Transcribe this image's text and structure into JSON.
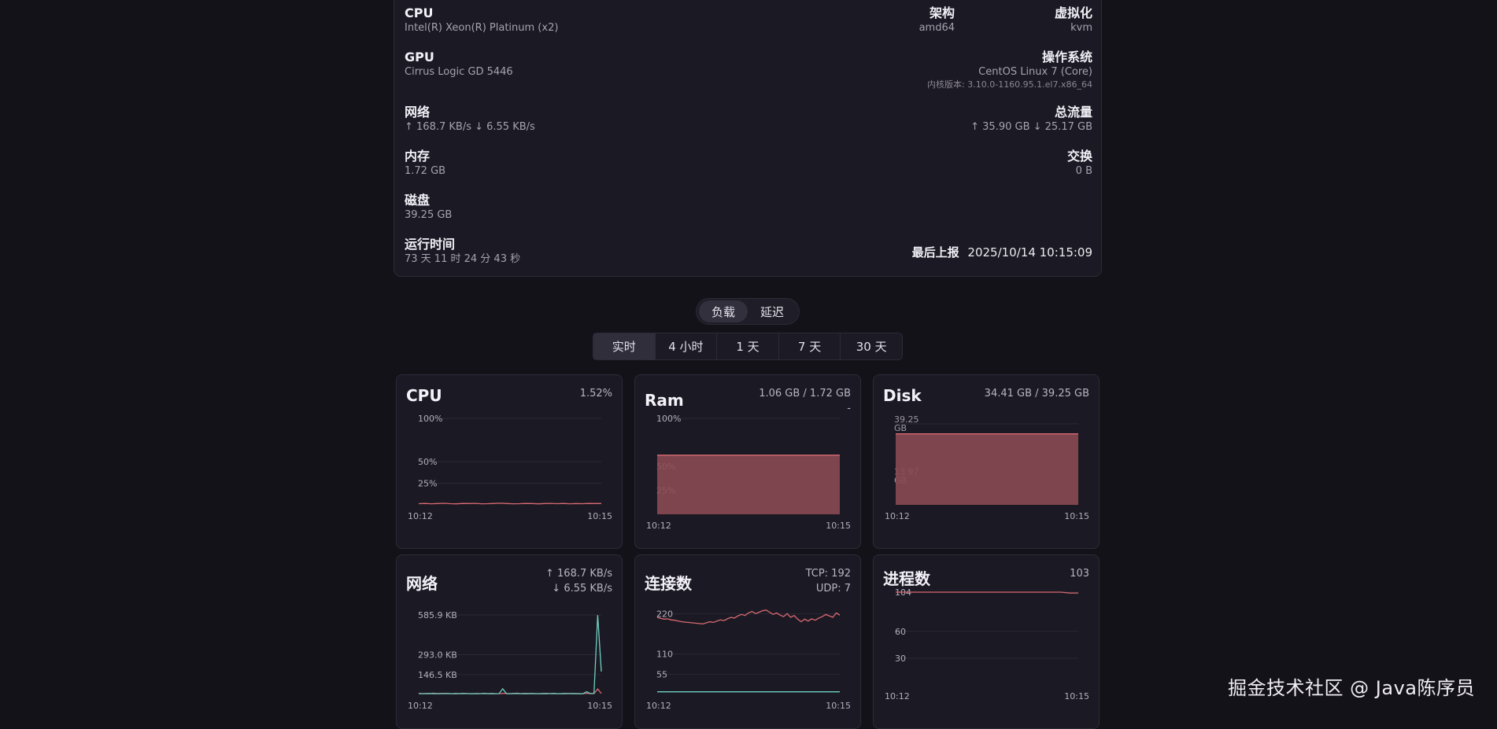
{
  "info": {
    "cpu": {
      "label": "CPU",
      "value": "Intel(R) Xeon(R) Platinum (x2)"
    },
    "arch": {
      "label": "架构",
      "value": "amd64"
    },
    "virt": {
      "label": "虚拟化",
      "value": "kvm"
    },
    "gpu": {
      "label": "GPU",
      "value": "Cirrus Logic GD 5446"
    },
    "os": {
      "label": "操作系统",
      "value": "CentOS Linux 7 (Core)",
      "kernel": "内核版本: 3.10.0-1160.95.1.el7.x86_64"
    },
    "net": {
      "label": "网络",
      "value": "↑ 168.7 KB/s ↓ 6.55 KB/s"
    },
    "traffic": {
      "label": "总流量",
      "value": "↑ 35.90 GB ↓ 25.17 GB"
    },
    "mem": {
      "label": "内存",
      "value": "1.72 GB"
    },
    "swap": {
      "label": "交换",
      "value": "0 B"
    },
    "disk": {
      "label": "磁盘",
      "value": "39.25 GB"
    },
    "uptime": {
      "label": "运行时间",
      "value": "73 天 11 时 24 分 43 秒"
    },
    "last_report": {
      "label": "最后上报",
      "value": "2025/10/14 10:15:09"
    }
  },
  "tabs": [
    {
      "label": "负载",
      "active": true
    },
    {
      "label": "延迟",
      "active": false
    }
  ],
  "ranges": [
    {
      "label": "实时",
      "active": true
    },
    {
      "label": "4 小时",
      "active": false
    },
    {
      "label": "1 天",
      "active": false
    },
    {
      "label": "7 天",
      "active": false
    },
    {
      "label": "30 天",
      "active": false
    }
  ],
  "colors": {
    "red": "#d86a72",
    "fill": "#8a4a53",
    "teal": "#6fd0c0",
    "grid": "#2b2935"
  },
  "chart_data": [
    {
      "id": "cpu",
      "type": "line",
      "title": "CPU",
      "value_lines": [
        "1.52%"
      ],
      "x_labels": [
        "10:12",
        "10:15"
      ],
      "y_ticks": [
        "100%",
        "50%",
        "25%"
      ],
      "ylim": [
        0,
        100
      ],
      "series": [
        {
          "color": "#d86a72",
          "values": [
            1.4,
            1.6,
            1.3,
            1.5,
            1.8,
            1.4,
            1.2,
            1.6,
            1.5,
            1.7,
            1.3,
            1.4,
            1.6,
            1.9,
            1.5,
            1.3,
            1.4,
            1.6,
            1.5,
            1.2,
            1.5,
            1.7,
            1.4,
            1.6,
            1.3,
            1.5,
            1.4,
            1.6,
            1.5,
            1.52
          ]
        }
      ]
    },
    {
      "id": "ram",
      "type": "area",
      "title": "Ram",
      "value_lines": [
        "1.06 GB / 1.72 GB",
        "-"
      ],
      "x_labels": [
        "10:12",
        "10:15"
      ],
      "y_ticks": [
        "100%",
        "50%",
        "25%"
      ],
      "ylim": [
        0,
        100
      ],
      "series": [
        {
          "color": "#d86a72",
          "values": [
            61.6,
            61.6,
            61.6,
            61.6,
            61.6,
            61.6,
            61.6,
            61.6,
            61.6,
            61.6,
            61.6,
            61.6
          ]
        }
      ]
    },
    {
      "id": "disk",
      "type": "area",
      "title": "Disk",
      "value_lines": [
        "34.41 GB / 39.25 GB"
      ],
      "x_labels": [
        "10:12",
        "10:15"
      ],
      "y_ticks": [
        "39.25 GB",
        "13.97 GB"
      ],
      "ylim": [
        0,
        39.25
      ],
      "series": [
        {
          "color": "#d86a72",
          "values": [
            34.41,
            34.41,
            34.41,
            34.41,
            34.41,
            34.41,
            34.41,
            34.41,
            34.41,
            34.41
          ]
        }
      ]
    },
    {
      "id": "network",
      "type": "line",
      "title": "网络",
      "value_lines": [
        "↑ 168.7 KB/s",
        "↓ 6.55 KB/s"
      ],
      "x_labels": [
        "10:12",
        "10:15"
      ],
      "y_ticks": [
        "585.9 KB",
        "293.0 KB",
        "146.5 KB"
      ],
      "ylim": [
        0,
        650
      ],
      "series": [
        {
          "color": "#d86a72",
          "values": [
            8,
            6,
            7,
            5,
            9,
            6,
            7,
            8,
            6,
            5,
            7,
            6,
            8,
            7,
            6,
            5,
            7,
            6,
            8,
            6,
            7,
            5,
            6,
            7,
            8,
            6,
            7,
            9,
            6,
            8,
            7,
            6,
            5,
            6,
            7,
            8,
            6,
            7,
            5,
            6,
            8,
            7,
            6,
            7,
            5,
            6,
            8,
            7,
            6,
            40,
            6.55
          ]
        },
        {
          "color": "#6fd0c0",
          "values": [
            6,
            5,
            6,
            7,
            5,
            6,
            5,
            6,
            7,
            5,
            6,
            5,
            7,
            6,
            5,
            6,
            5,
            6,
            7,
            5,
            6,
            5,
            6,
            42,
            6,
            5,
            7,
            6,
            5,
            6,
            5,
            7,
            6,
            5,
            6,
            5,
            6,
            7,
            5,
            6,
            5,
            6,
            7,
            5,
            6,
            5,
            20,
            6,
            7,
            585,
            168.7
          ]
        }
      ]
    },
    {
      "id": "connections",
      "type": "line",
      "title": "连接数",
      "value_lines": [
        "TCP: 192",
        "UDP: 7"
      ],
      "x_labels": [
        "10:12",
        "10:15"
      ],
      "y_ticks": [
        "220",
        "110",
        "55"
      ],
      "ylim": [
        0,
        240
      ],
      "series": [
        {
          "color": "#d86a72",
          "values": [
            210,
            207,
            205,
            206,
            203,
            202,
            200,
            198,
            197,
            196,
            195,
            194,
            193,
            192,
            195,
            198,
            196,
            200,
            203,
            201,
            206,
            210,
            208,
            214,
            218,
            215,
            222,
            226,
            220,
            224,
            228,
            230,
            224,
            218,
            222,
            216,
            212,
            220,
            210,
            215,
            205,
            198,
            205,
            200,
            206,
            202,
            208,
            212,
            218,
            214,
            210,
            222,
            216
          ]
        },
        {
          "color": "#6fd0c0",
          "values": [
            7,
            7,
            7,
            7,
            7,
            7,
            7,
            7,
            7,
            7,
            7,
            7,
            7,
            7,
            7,
            7,
            7,
            7,
            7,
            7,
            7,
            7,
            7,
            7,
            7,
            7,
            7,
            7,
            7,
            7,
            7,
            7,
            7,
            7,
            7,
            7,
            7,
            7,
            7,
            7,
            7,
            7,
            7,
            7,
            7,
            7,
            7,
            7,
            7,
            7,
            7,
            7,
            7
          ]
        }
      ]
    },
    {
      "id": "processes",
      "type": "line",
      "title": "进程数",
      "value_lines": [
        "103"
      ],
      "x_labels": [
        "10:12",
        "10:15"
      ],
      "y_ticks": [
        "104",
        "60",
        "30"
      ],
      "ylim": [
        0,
        104
      ],
      "series": [
        {
          "color": "#d86a72",
          "values": [
            104,
            104,
            104,
            104,
            104,
            104,
            104,
            104,
            104,
            104,
            104,
            104,
            104,
            104,
            104,
            104,
            104,
            104,
            104,
            104,
            103,
            103
          ]
        }
      ]
    }
  ],
  "watermark": "掘金技术社区 @ Java陈序员"
}
